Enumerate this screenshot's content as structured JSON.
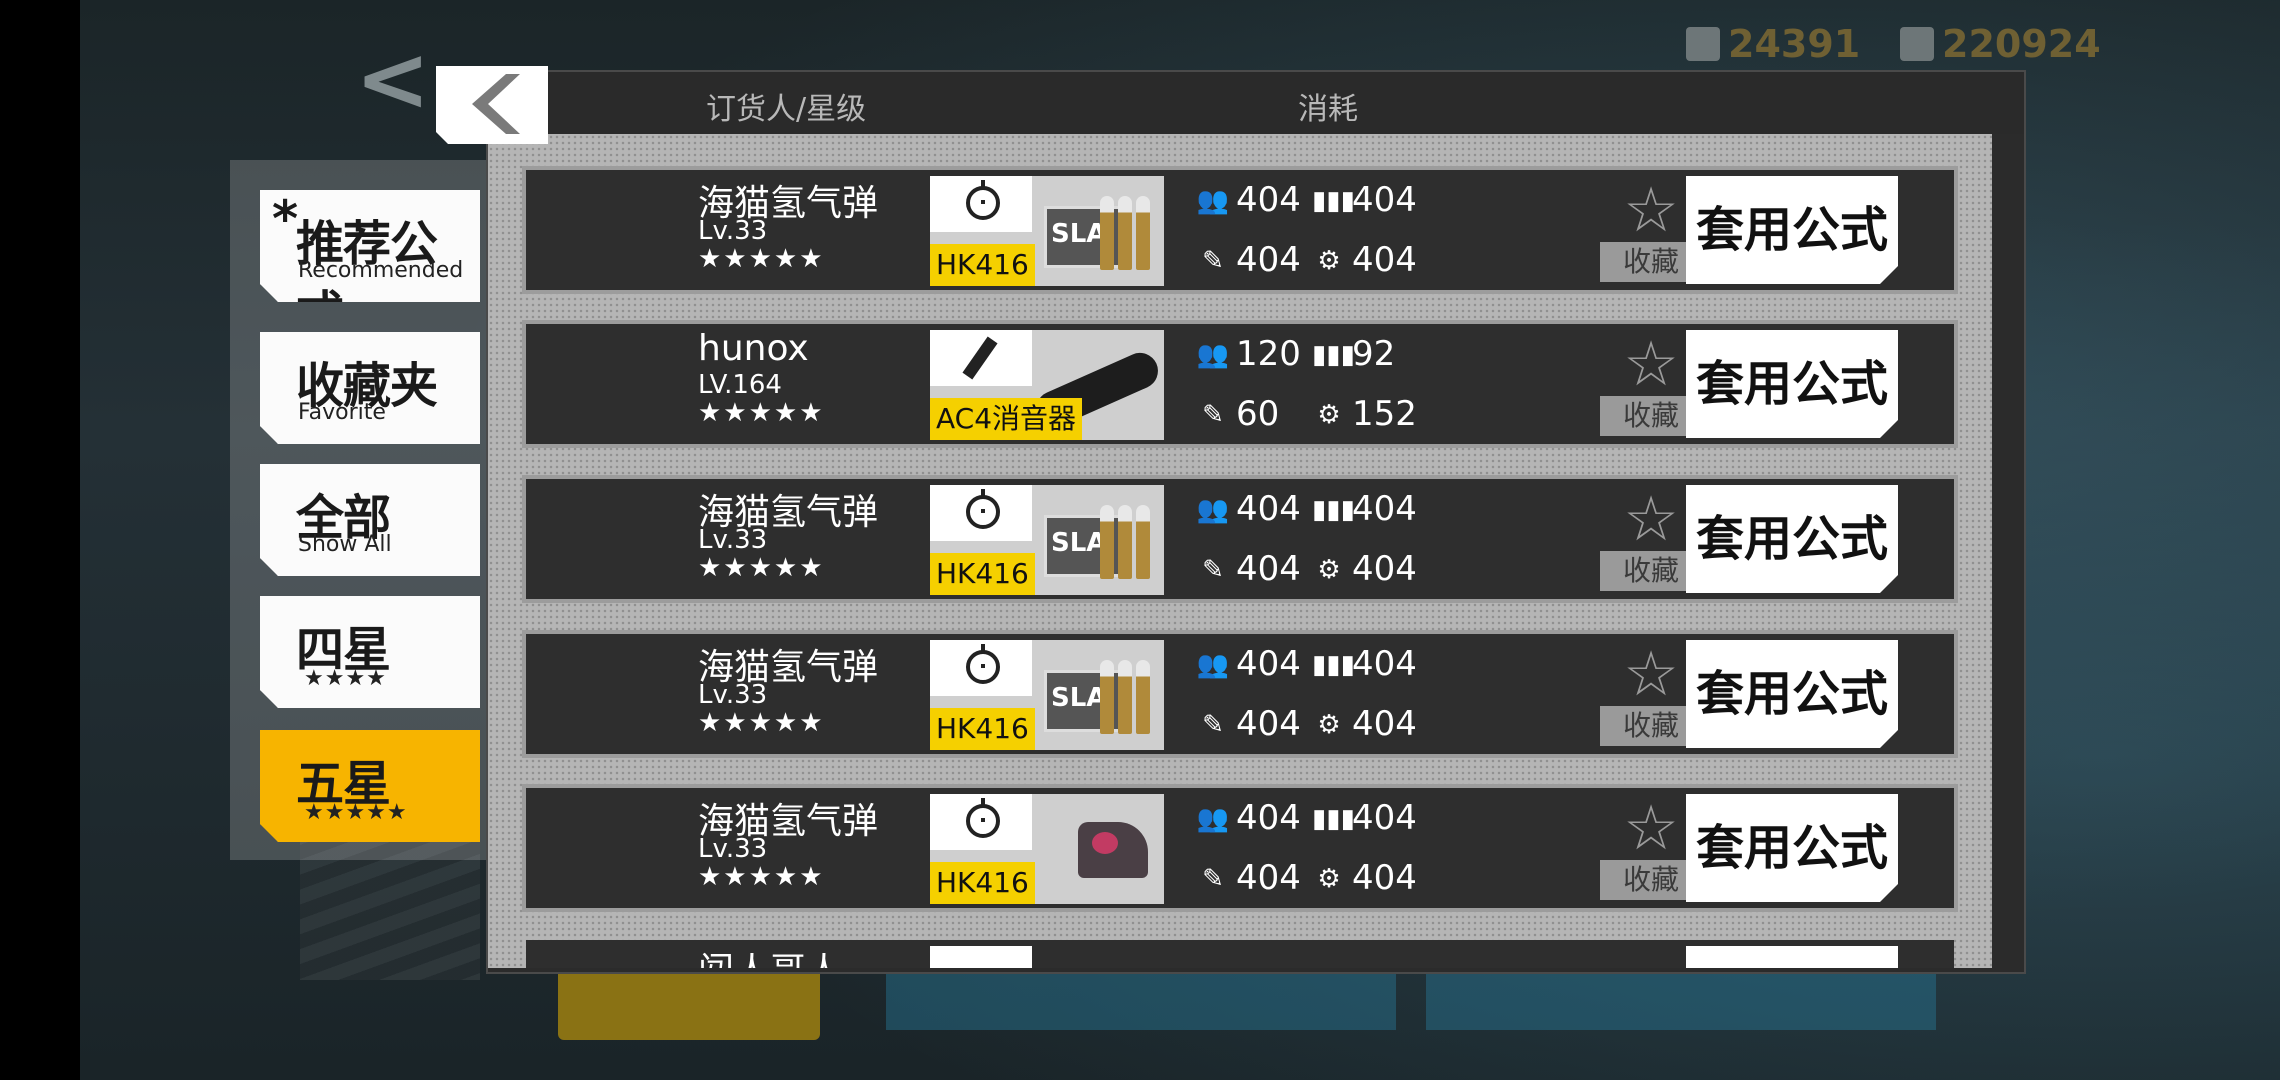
{
  "background": {
    "resource_left": "24391",
    "resource_right": "220924",
    "back_glyph": "<"
  },
  "tabs": [
    {
      "cn": "推荐公式",
      "en": "Recommended",
      "mark": "*",
      "active": false
    },
    {
      "cn": "收藏夹",
      "en": "Favorite",
      "active": false
    },
    {
      "cn": "全部",
      "en": "Show All",
      "active": false
    },
    {
      "cn": "四星",
      "stars": "★★★★",
      "active": false
    },
    {
      "cn": "五星",
      "stars": "★★★★★",
      "active": true
    }
  ],
  "panel": {
    "back_glyph": "❮",
    "header_orderer": "订货人/星级",
    "header_cost": "消耗"
  },
  "resource_icons": {
    "manpower": "manpower-icon",
    "ammo": "ammo-icon",
    "rations": "rations-icon",
    "parts": "parts-icon"
  },
  "rows": [
    {
      "name": "海猫氢气弹",
      "level": "Lv.33",
      "stars": "★★★★★",
      "item_label": "HK416",
      "item_type": "ammo",
      "item_art": "SLA",
      "manpower": "404",
      "ammo": "404",
      "rations": "404",
      "parts": "404",
      "fav_label": "收藏",
      "apply_label": "套用公式"
    },
    {
      "name": "hunox",
      "level": "LV.164",
      "stars": "★★★★★",
      "item_label": "AC4消音器",
      "item_type": "silencer",
      "item_art": "",
      "manpower": "120",
      "ammo": "92",
      "rations": "60",
      "parts": "152",
      "fav_label": "收藏",
      "apply_label": "套用公式"
    },
    {
      "name": "海猫氢气弹",
      "level": "Lv.33",
      "stars": "★★★★★",
      "item_label": "HK416",
      "item_type": "ammo",
      "item_art": "SLA",
      "manpower": "404",
      "ammo": "404",
      "rations": "404",
      "parts": "404",
      "fav_label": "收藏",
      "apply_label": "套用公式"
    },
    {
      "name": "海猫氢气弹",
      "level": "Lv.33",
      "stars": "★★★★★",
      "item_label": "HK416",
      "item_type": "ammo",
      "item_art": "SLA",
      "manpower": "404",
      "ammo": "404",
      "rations": "404",
      "parts": "404",
      "fav_label": "收藏",
      "apply_label": "套用公式"
    },
    {
      "name": "海猫氢气弹",
      "level": "Lv.33",
      "stars": "★★★★★",
      "item_label": "HK416",
      "item_type": "sight",
      "item_art": "",
      "manpower": "404",
      "ammo": "404",
      "rations": "404",
      "parts": "404",
      "fav_label": "收藏",
      "apply_label": "套用公式"
    }
  ],
  "peek_row": {
    "name": "闯人哥人"
  }
}
